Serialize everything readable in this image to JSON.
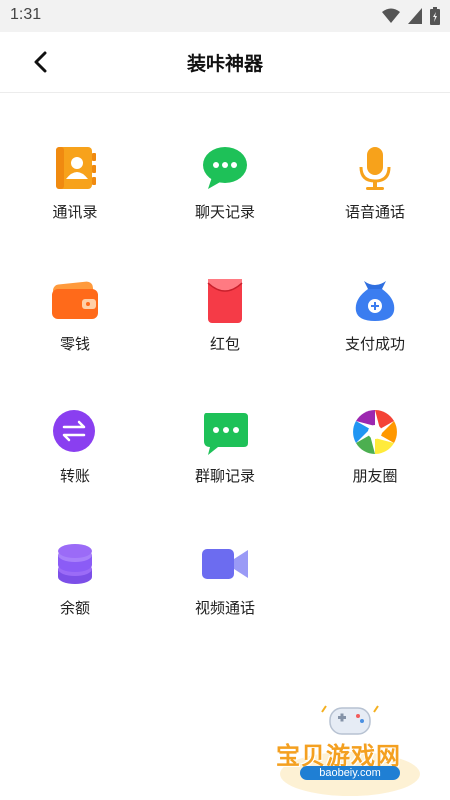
{
  "status_bar": {
    "time": "1:31"
  },
  "header": {
    "title": "装咔神器"
  },
  "grid": {
    "items": [
      {
        "label": "通讯录",
        "icon": "contacts-book-icon"
      },
      {
        "label": "聊天记录",
        "icon": "chat-bubble-icon"
      },
      {
        "label": "语音通话",
        "icon": "microphone-icon"
      },
      {
        "label": "零钱",
        "icon": "wallet-icon"
      },
      {
        "label": "红包",
        "icon": "red-packet-icon"
      },
      {
        "label": "支付成功",
        "icon": "money-bag-icon"
      },
      {
        "label": "转账",
        "icon": "transfer-icon"
      },
      {
        "label": "群聊记录",
        "icon": "group-chat-icon"
      },
      {
        "label": "朋友圈",
        "icon": "moments-aperture-icon"
      },
      {
        "label": "余额",
        "icon": "balance-stack-icon"
      },
      {
        "label": "视频通话",
        "icon": "video-camera-icon"
      }
    ]
  },
  "watermark": {
    "text": "宝贝游戏网",
    "url": "baobeiy.com"
  },
  "colors": {
    "contacts": "#f7a21b",
    "chat_green": "#1ec158",
    "mic": "#f7a21b",
    "wallet": "#ff7a1a",
    "red_packet": "#f53b47",
    "money_bag": "#2f6fe0",
    "transfer": "#8a3ff0",
    "balance": "#8b5cf6",
    "video": "#6c6cf0"
  }
}
